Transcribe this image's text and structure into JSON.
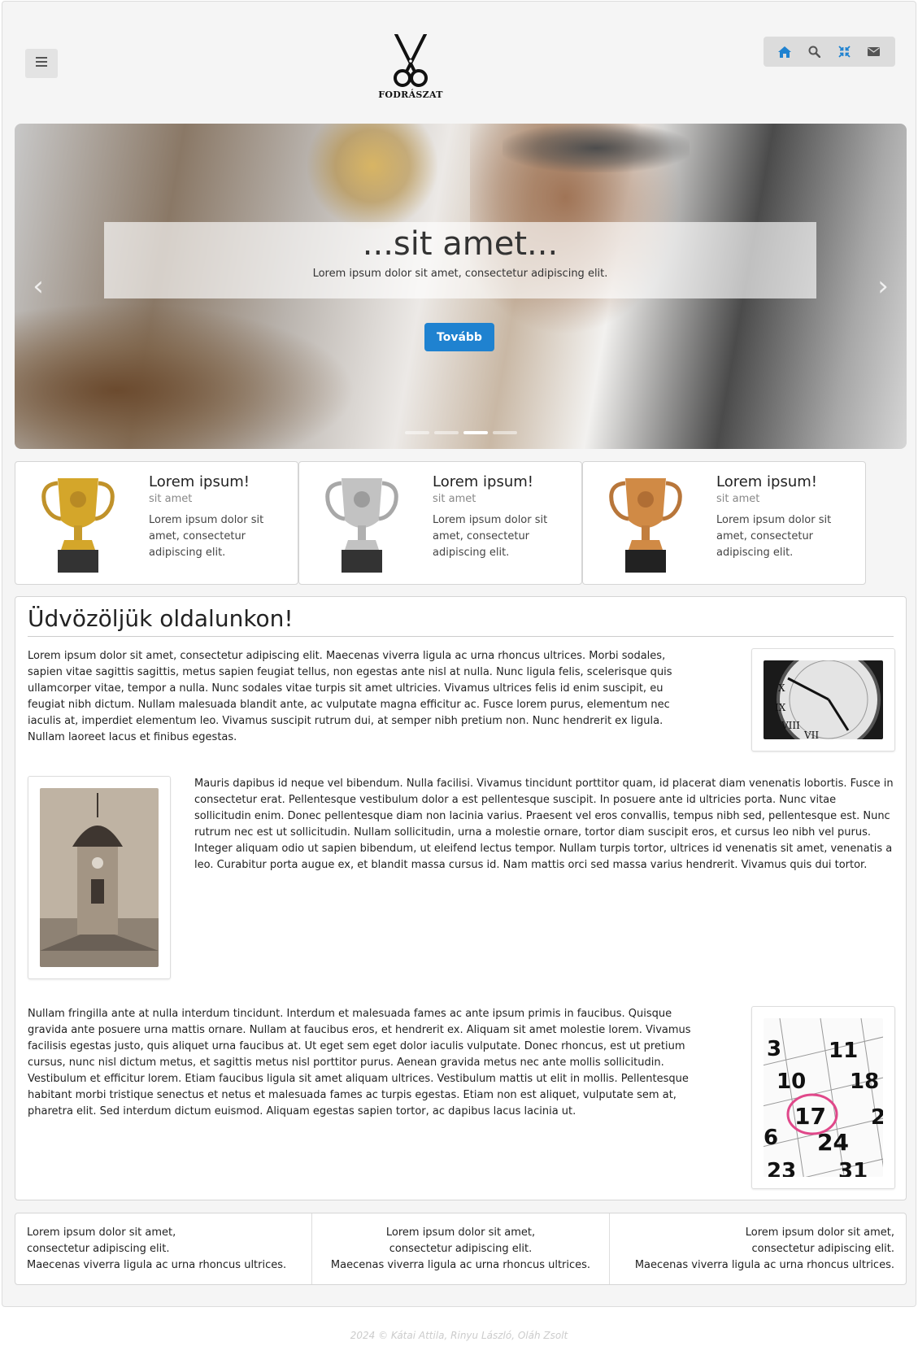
{
  "header": {
    "menu_icon": "hamburger-icon",
    "logo_text": "FODRÁSZAT",
    "toolbar": [
      {
        "icon": "home-icon",
        "color": "#1f82d0"
      },
      {
        "icon": "search-icon",
        "color": "#555555"
      },
      {
        "icon": "compress-icon",
        "color": "#1f82d0"
      },
      {
        "icon": "envelope-icon",
        "color": "#555555"
      }
    ]
  },
  "carousel": {
    "title": "...sit amet...",
    "text": "Lorem ipsum dolor sit amet, consectetur adipiscing elit.",
    "button_label": "Tovább",
    "prev_icon": "chevron-left-icon",
    "next_icon": "chevron-right-icon",
    "active_slide": 3,
    "slide_count": 4
  },
  "cards": [
    {
      "title": "Lorem ipsum!",
      "subtitle": "sit amet",
      "text": "Lorem ipsum dolor sit amet, consectetur adipiscing elit.",
      "trophy": "gold",
      "color": "#d4a62a"
    },
    {
      "title": "Lorem ipsum!",
      "subtitle": "sit amet",
      "text": "Lorem ipsum dolor sit amet, consectetur adipiscing elit.",
      "trophy": "silver",
      "color": "#b9b9b9"
    },
    {
      "title": "Lorem ipsum!",
      "subtitle": "sit amet",
      "text": "Lorem ipsum dolor sit amet, consectetur adipiscing elit.",
      "trophy": "bronze",
      "color": "#d08a45"
    }
  ],
  "main": {
    "heading": "Üdvözöljük oldalunkon!",
    "paragraphs": [
      "Lorem ipsum dolor sit amet, consectetur adipiscing elit. Maecenas viverra ligula ac urna rhoncus ultrices. Morbi sodales, sapien vitae sagittis sagittis, metus sapien feugiat tellus, non egestas ante nisl at nulla. Nunc ligula felis, scelerisque quis ullamcorper vitae, tempor a nulla. Nunc sodales vitae turpis sit amet ultricies. Vivamus ultrices felis id enim suscipit, eu feugiat nibh dictum. Nullam malesuada blandit ante, ac vulputate magna efficitur ac. Fusce lorem purus, elementum nec iaculis at, imperdiet elementum leo. Vivamus suscipit rutrum dui, at semper nibh pretium non. Nunc hendrerit ex ligula. Nullam laoreet lacus et finibus egestas.",
      "Mauris dapibus id neque vel bibendum. Nulla facilisi. Vivamus tincidunt porttitor quam, id placerat diam venenatis lobortis. Fusce in consectetur erat. Pellentesque vestibulum dolor a est pellentesque suscipit. In posuere ante id ultricies porta. Nunc vitae sollicitudin enim. Donec pellentesque diam non lacinia varius. Praesent vel eros convallis, tempus nibh sed, pellentesque est. Nunc rutrum nec est ut sollicitudin. Nullam sollicitudin, urna a molestie ornare, tortor diam suscipit eros, et cursus leo nibh vel purus. Integer aliquam odio ut sapien bibendum, ut eleifend lectus tempor. Nullam turpis tortor, ultrices id venenatis sit amet, venenatis a leo. Curabitur porta augue ex, et blandit massa cursus id. Nam mattis orci sed massa varius hendrerit. Vivamus quis dui tortor.",
      "Nullam fringilla ante at nulla interdum tincidunt. Interdum et malesuada fames ac ante ipsum primis in faucibus. Quisque gravida ante posuere urna mattis ornare. Nullam at faucibus eros, et hendrerit ex. Aliquam sit amet molestie lorem. Vivamus facilisis egestas justo, quis aliquet urna faucibus at. Ut eget sem eget dolor iaculis vulputate. Donec rhoncus, est ut pretium cursus, nunc nisl dictum metus, et sagittis metus nisl porttitor purus. Aenean gravida metus nec ante mollis sollicitudin. Vestibulum et efficitur lorem. Etiam faucibus ligula sit amet aliquam ultrices. Vestibulum mattis ut elit in mollis. Pellentesque habitant morbi tristique senectus et netus et malesuada fames ac turpis egestas. Etiam non est aliquet, vulputate sem at, pharetra elit. Sed interdum dictum euismod. Aliquam egestas sapien tortor, ac dapibus lacus lacinia ut."
    ],
    "images": [
      "clock-image",
      "church-tower-image",
      "calendar-image"
    ],
    "calendar_numbers": [
      "3",
      "11",
      "10",
      "18",
      "17",
      "6",
      "24",
      "2",
      "23",
      "31"
    ]
  },
  "footer_columns": [
    {
      "lines": [
        "Lorem ipsum dolor sit amet,",
        "consectetur adipiscing elit.",
        "Maecenas viverra ligula ac urna rhoncus ultrices."
      ],
      "align": "left"
    },
    {
      "lines": [
        "Lorem ipsum dolor sit amet,",
        "consectetur adipiscing elit.",
        "Maecenas viverra ligula ac urna rhoncus ultrices."
      ],
      "align": "center"
    },
    {
      "lines": [
        "Lorem ipsum dolor sit amet,",
        "consectetur adipiscing elit.",
        "Maecenas viverra ligula ac urna rhoncus ultrices."
      ],
      "align": "right"
    }
  ],
  "copyright": "2024 © Kátai Attila, Rinyu László, Oláh Zsolt"
}
